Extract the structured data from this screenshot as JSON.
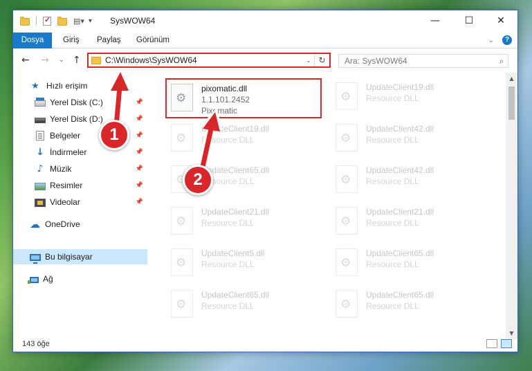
{
  "window": {
    "title": "SysWOW64",
    "controls": {
      "minimize": "—",
      "maximize": "☐",
      "close": "✕"
    }
  },
  "ribbon": {
    "file_tab": "Dosya",
    "tabs": [
      "Giriş",
      "Paylaş",
      "Görünüm"
    ]
  },
  "address": {
    "path": "C:\\Windows\\SysWOW64",
    "search_placeholder": "Ara: SysWOW64"
  },
  "nav": {
    "items": [
      {
        "label": "Hızlı erişim",
        "icon": "star-icon",
        "pinned": false
      },
      {
        "label": "Yerel Disk (C:)",
        "icon": "disk-icon",
        "pinned": true
      },
      {
        "label": "Yerel Disk (D:)",
        "icon": "disk-icon",
        "pinned": true
      },
      {
        "label": "Belgeler",
        "icon": "documents-icon",
        "pinned": true
      },
      {
        "label": "İndirmeler",
        "icon": "download-icon",
        "pinned": true
      },
      {
        "label": "Müzik",
        "icon": "music-icon",
        "pinned": true
      },
      {
        "label": "Resimler",
        "icon": "pictures-icon",
        "pinned": true
      },
      {
        "label": "Videolar",
        "icon": "videos-icon",
        "pinned": true
      },
      {
        "label": "OneDrive",
        "icon": "cloud-icon",
        "pinned": false
      },
      {
        "label": "Bu bilgisayar",
        "icon": "computer-icon",
        "pinned": false,
        "selected": true
      },
      {
        "label": "Ağ",
        "icon": "network-icon",
        "pinned": false
      }
    ]
  },
  "files": [
    {
      "name": "pixomatic.dll",
      "lines": [
        "1.1.101.2452",
        "Pixomatic"
      ],
      "selected": true
    },
    {
      "name": "UpdateClient19.dll",
      "lines": [
        "Resource DLL"
      ]
    },
    {
      "name": "UpdateClient19.dll",
      "lines": [
        "Resource DLL"
      ]
    },
    {
      "name": "UpdateClient42.dll",
      "lines": [
        "Resource DLL"
      ]
    },
    {
      "name": "UpdateClient65.dll",
      "lines": [
        "Resource DLL"
      ]
    },
    {
      "name": "UpdateClient42.dll",
      "lines": [
        "Resource DLL"
      ]
    },
    {
      "name": "UpdateClient21.dll",
      "lines": [
        "Resource DLL"
      ]
    },
    {
      "name": "UpdateClient21.dll",
      "lines": [
        "Resource DLL"
      ]
    },
    {
      "name": "UpdateClient5.dll",
      "lines": [
        "Resource DLL"
      ]
    },
    {
      "name": "UpdateClient65.dll",
      "lines": [
        "Resource DLL"
      ]
    },
    {
      "name": "UpdateClient65.dll",
      "lines": [
        "Resource DLL"
      ]
    },
    {
      "name": "UpdateClient65.dll",
      "lines": [
        "Resource DLL"
      ]
    }
  ],
  "status": {
    "count": "143 öğe"
  },
  "annotations": {
    "step1": "1",
    "step2": "2",
    "color": "#d9262b"
  }
}
